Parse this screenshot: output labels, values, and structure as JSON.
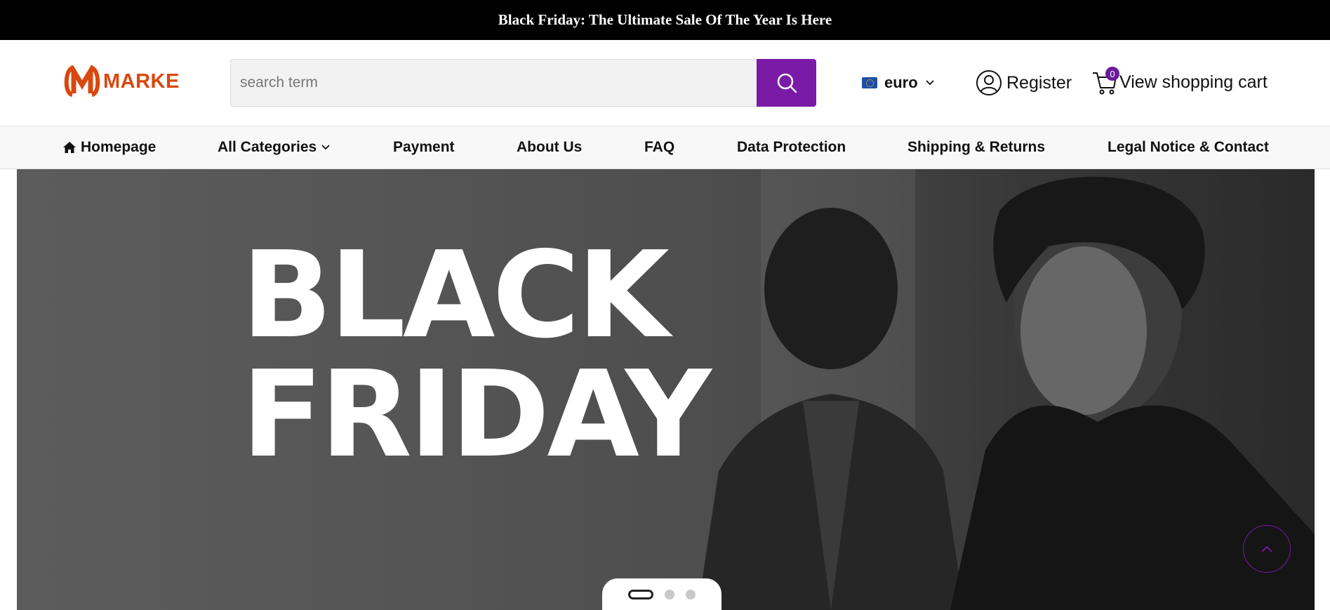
{
  "announcement": {
    "text": "Black Friday: The Ultimate Sale Of The Year Is Here"
  },
  "header": {
    "logo_text": "MARKE",
    "search": {
      "placeholder": "search term",
      "value": ""
    },
    "currency": {
      "label": "euro",
      "flag_icon": "eu-flag-icon"
    },
    "register_label": "Register",
    "cart": {
      "label": "View shopping cart",
      "count": "0"
    }
  },
  "nav": {
    "items": [
      {
        "label": "Homepage",
        "icon": "home-icon"
      },
      {
        "label": "All Categories",
        "icon": "chevron-down-icon"
      },
      {
        "label": "Payment"
      },
      {
        "label": "About Us"
      },
      {
        "label": "FAQ"
      },
      {
        "label": "Data Protection"
      },
      {
        "label": "Shipping & Returns"
      },
      {
        "label": "Legal Notice & Contact"
      }
    ]
  },
  "hero": {
    "headline_line1": "BLACK",
    "headline_line2": "FRIDAY",
    "slides_total": 3,
    "active_slide": 1
  },
  "colors": {
    "accent": "#7a1aa6",
    "logo": "#d9480f",
    "announcement_bg": "#000000"
  }
}
